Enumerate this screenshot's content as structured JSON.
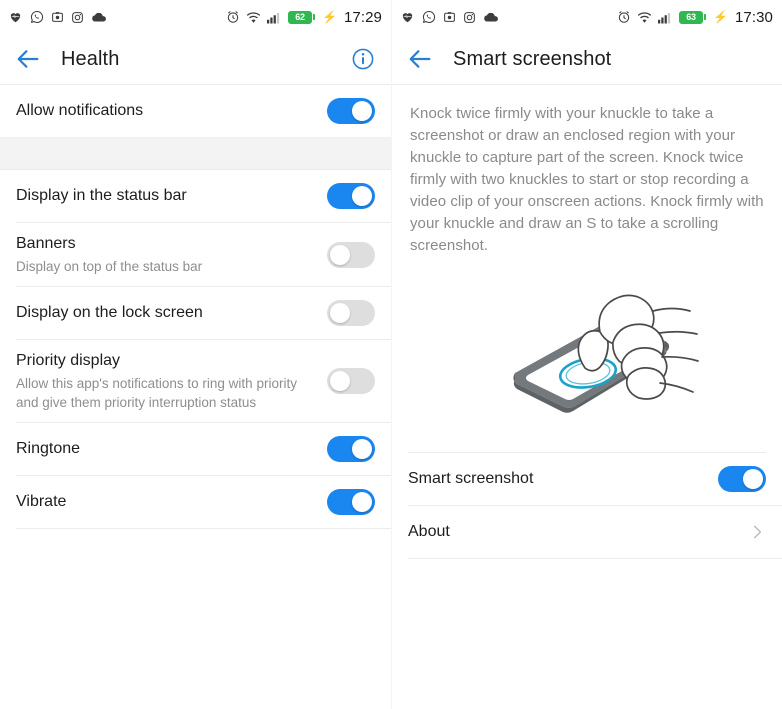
{
  "left": {
    "status_bar": {
      "icons": [
        "heart-health-icon",
        "whatsapp-icon",
        "screenshot-icon",
        "instagram-icon",
        "cloud-icon"
      ],
      "alarm_icon": "alarm-icon",
      "wifi_icon": "wifi-icon",
      "signal_icon": "signal-icon",
      "battery_percent": "62",
      "charging_icon": "charging-bolt-icon",
      "time": "17:29"
    },
    "appbar": {
      "back_icon": "back-arrow-icon",
      "title": "Health",
      "info_icon": "info-icon"
    },
    "rows": [
      {
        "title": "Allow notifications",
        "sub": "",
        "control": "toggle",
        "state": "on"
      },
      {
        "title": "Display in the status bar",
        "sub": "",
        "control": "toggle",
        "state": "on"
      },
      {
        "title": "Banners",
        "sub": "Display on top of the status bar",
        "control": "toggle",
        "state": "off"
      },
      {
        "title": "Display on the lock screen",
        "sub": "",
        "control": "toggle",
        "state": "off"
      },
      {
        "title": "Priority display",
        "sub": "Allow this app's notifications to ring with priority and give them priority interruption status",
        "control": "toggle",
        "state": "off"
      },
      {
        "title": "Ringtone",
        "sub": "",
        "control": "toggle",
        "state": "on"
      },
      {
        "title": "Vibrate",
        "sub": "",
        "control": "toggle",
        "state": "on"
      }
    ]
  },
  "right": {
    "status_bar": {
      "icons": [
        "heart-health-icon",
        "whatsapp-icon",
        "screenshot-icon",
        "instagram-icon",
        "cloud-icon"
      ],
      "alarm_icon": "alarm-icon",
      "wifi_icon": "wifi-icon",
      "signal_icon": "signal-icon",
      "battery_percent": "63",
      "charging_icon": "charging-bolt-icon",
      "time": "17:30"
    },
    "appbar": {
      "back_icon": "back-arrow-icon",
      "title": "Smart screenshot"
    },
    "description": "Knock twice firmly with your knuckle to take a screenshot or draw an enclosed region with your knuckle to capture part of the screen. Knock twice firmly with two knuckles to start or stop recording a video clip of your onscreen actions. Knock firmly with your knuckle and draw an S to take a scrolling screenshot.",
    "illustration": "knuckle-knock-on-phone-illustration",
    "rows": [
      {
        "title": "Smart screenshot",
        "control": "toggle",
        "state": "on"
      },
      {
        "title": "About",
        "control": "chevron",
        "chevron_icon": "chevron-right-icon"
      }
    ]
  },
  "colors": {
    "toggle_on": "#1a86ef",
    "toggle_off": "#dedede",
    "accent_blue": "#2a7fd4",
    "battery_green": "#2eb84f",
    "title_text": "#1d1d1d",
    "sub_text": "#8e8e8e",
    "divider": "#ececec",
    "band": "#f3f3f3",
    "ripple_blue": "#1aa3c8",
    "phone_gray": "#6e7377"
  }
}
